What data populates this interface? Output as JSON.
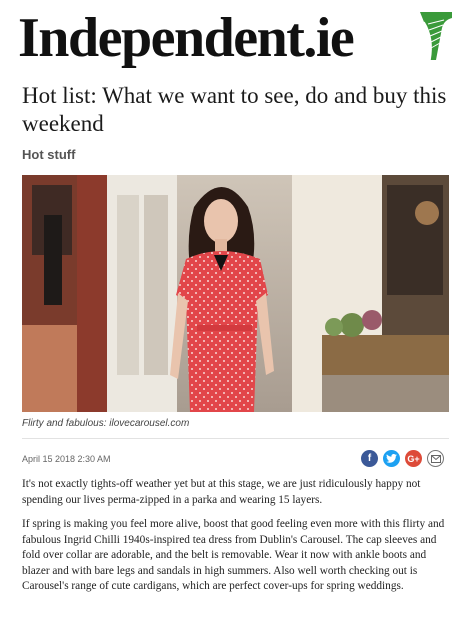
{
  "masthead": {
    "brand": "Independent.ie",
    "logo_icon": "harp-icon"
  },
  "article": {
    "headline": "Hot list: What we want to see, do and buy this weekend",
    "section": "Hot stuff",
    "image_caption": "Flirty and fabulous: ilovecarousel.com",
    "date": "April 15 2018 2:30 AM",
    "paragraphs": [
      "It's not exactly tights-off weather yet but at this stage, we are just ridiculously happy not spending our lives perma-zipped in a parka and wearing 15 layers.",
      "If spring is making you feel more alive, boost that good feeling even more with this flirty and fabulous Ingrid Chilli 1940s-inspired tea dress from Dublin's Carousel. The cap sleeves and fold over collar are adorable, and the belt is removable. Wear it now with ankle boots and blazer and with bare legs and sandals in high summers. Also well worth checking out is Carousel's range of cute cardigans, which are perfect cover-ups for spring weddings."
    ]
  },
  "share": {
    "facebook": "f",
    "twitter_icon": "twitter-bird-icon",
    "google_plus": "G+",
    "email_icon": "envelope-icon"
  },
  "colors": {
    "harp_green": "#3a9a3a",
    "facebook": "#3b5998",
    "twitter": "#1da1f2",
    "google_plus": "#dd4b39",
    "dress_red": "#e2464a"
  }
}
